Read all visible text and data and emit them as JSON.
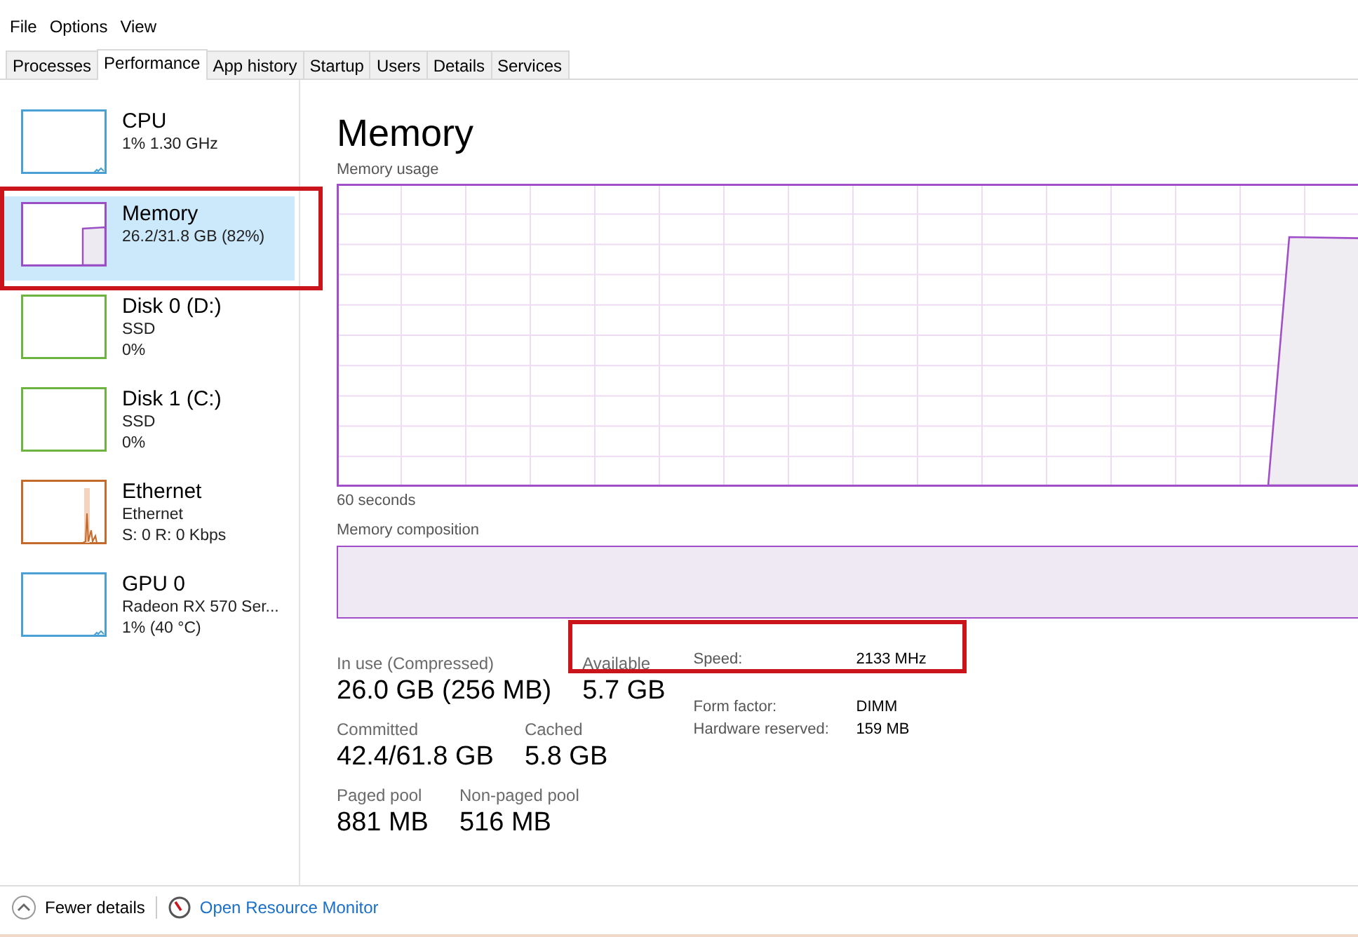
{
  "menu": [
    "File",
    "Options",
    "View"
  ],
  "tabs": [
    {
      "label": "Processes",
      "selected": false
    },
    {
      "label": "Performance",
      "selected": true
    },
    {
      "label": "App history",
      "selected": false
    },
    {
      "label": "Startup",
      "selected": false
    },
    {
      "label": "Users",
      "selected": false
    },
    {
      "label": "Details",
      "selected": false
    },
    {
      "label": "Services",
      "selected": false
    }
  ],
  "sidebar": {
    "items": [
      {
        "name": "CPU",
        "details": [
          "1% 1.30 GHz"
        ],
        "kind": "cpu",
        "color": "#4a9fd4",
        "selected": false,
        "highlighted": false
      },
      {
        "name": "Memory",
        "details": [
          "26.2/31.8 GB (82%)"
        ],
        "kind": "memory",
        "color": "#9b4fc4",
        "selected": true,
        "highlighted": true
      },
      {
        "name": "Disk 0 (D:)",
        "details": [
          "SSD",
          "0%"
        ],
        "kind": "disk",
        "color": "#6db33f",
        "selected": false,
        "highlighted": false
      },
      {
        "name": "Disk 1 (C:)",
        "details": [
          "SSD",
          "0%"
        ],
        "kind": "disk",
        "color": "#6db33f",
        "selected": false,
        "highlighted": false
      },
      {
        "name": "Ethernet",
        "details": [
          "Ethernet",
          "S: 0 R: 0 Kbps"
        ],
        "kind": "ethernet",
        "color": "#c46a2a",
        "selected": false,
        "highlighted": false
      },
      {
        "name": "GPU 0",
        "details": [
          "Radeon RX 570 Ser...",
          "1% (40 °C)"
        ],
        "kind": "gpu",
        "color": "#4a9fd4",
        "selected": false,
        "highlighted": false
      }
    ]
  },
  "performance": {
    "title": "Memory",
    "usage_label": "Memory usage",
    "time_label": "60 seconds",
    "composition_label": "Memory composition",
    "stats": [
      [
        {
          "label": "In use (Compressed)",
          "value": "26.0 GB (256 MB)"
        },
        {
          "label": "Available",
          "value": "5.7 GB"
        }
      ],
      [
        {
          "label": "Committed",
          "value": "42.4/61.8 GB"
        },
        {
          "label": "Cached",
          "value": "5.8 GB"
        }
      ],
      [
        {
          "label": "Paged pool",
          "value": "881 MB"
        },
        {
          "label": "Non-paged pool",
          "value": "516 MB"
        }
      ]
    ],
    "details": [
      {
        "label": "Speed:",
        "value": "2133 MHz"
      },
      {
        "label": "Form factor:",
        "value": "DIMM"
      },
      {
        "label": "Hardware reserved:",
        "value": "159 MB"
      }
    ],
    "highlighted": true
  },
  "footer": {
    "fewer_details": "Fewer details",
    "resource_monitor": "Open Resource Monitor"
  }
}
